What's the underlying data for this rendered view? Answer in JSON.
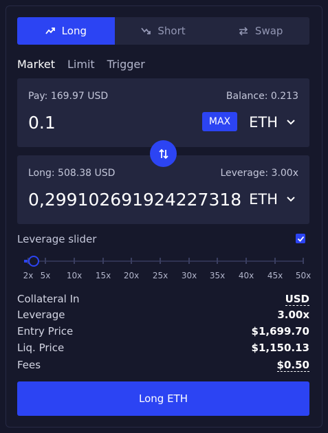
{
  "tabs": [
    {
      "label": "Long",
      "icon": "trend-up-icon",
      "active": true
    },
    {
      "label": "Short",
      "icon": "trend-down-icon",
      "active": false
    },
    {
      "label": "Swap",
      "icon": "swap-arrows-icon",
      "active": false
    }
  ],
  "order_types": [
    "Market",
    "Limit",
    "Trigger"
  ],
  "pay_box": {
    "pay_label": "Pay: 169.97 USD",
    "balance_label": "Balance: 0.213",
    "amount": "0.1",
    "max_label": "MAX",
    "token": "ETH"
  },
  "long_box": {
    "long_label": "Long: 508.38 USD",
    "leverage_label": "Leverage: 3.00x",
    "amount": "0,29910269192422731⁠8",
    "token": "ETH"
  },
  "leverage_slider": {
    "label": "Leverage slider",
    "enabled": true,
    "value": 3.0,
    "min": 1.1,
    "max": 50,
    "marks": [
      "2x",
      "5x",
      "10x",
      "15x",
      "20x",
      "25x",
      "30x",
      "35x",
      "40x",
      "45x",
      "50x"
    ]
  },
  "info": {
    "collateral_label": "Collateral In",
    "collateral_value": "USD",
    "leverage_label": "Leverage",
    "leverage_value": "3.00x",
    "entry_label": "Entry Price",
    "entry_value": "$1,699.70",
    "liq_label": "Liq. Price",
    "liq_value": "$1,150.13",
    "fees_label": "Fees",
    "fees_value": "$0.50"
  },
  "cta_label": "Long ETH",
  "colors": {
    "accent": "#2c44f3",
    "background": "#15172a",
    "panel": "#23263f"
  }
}
